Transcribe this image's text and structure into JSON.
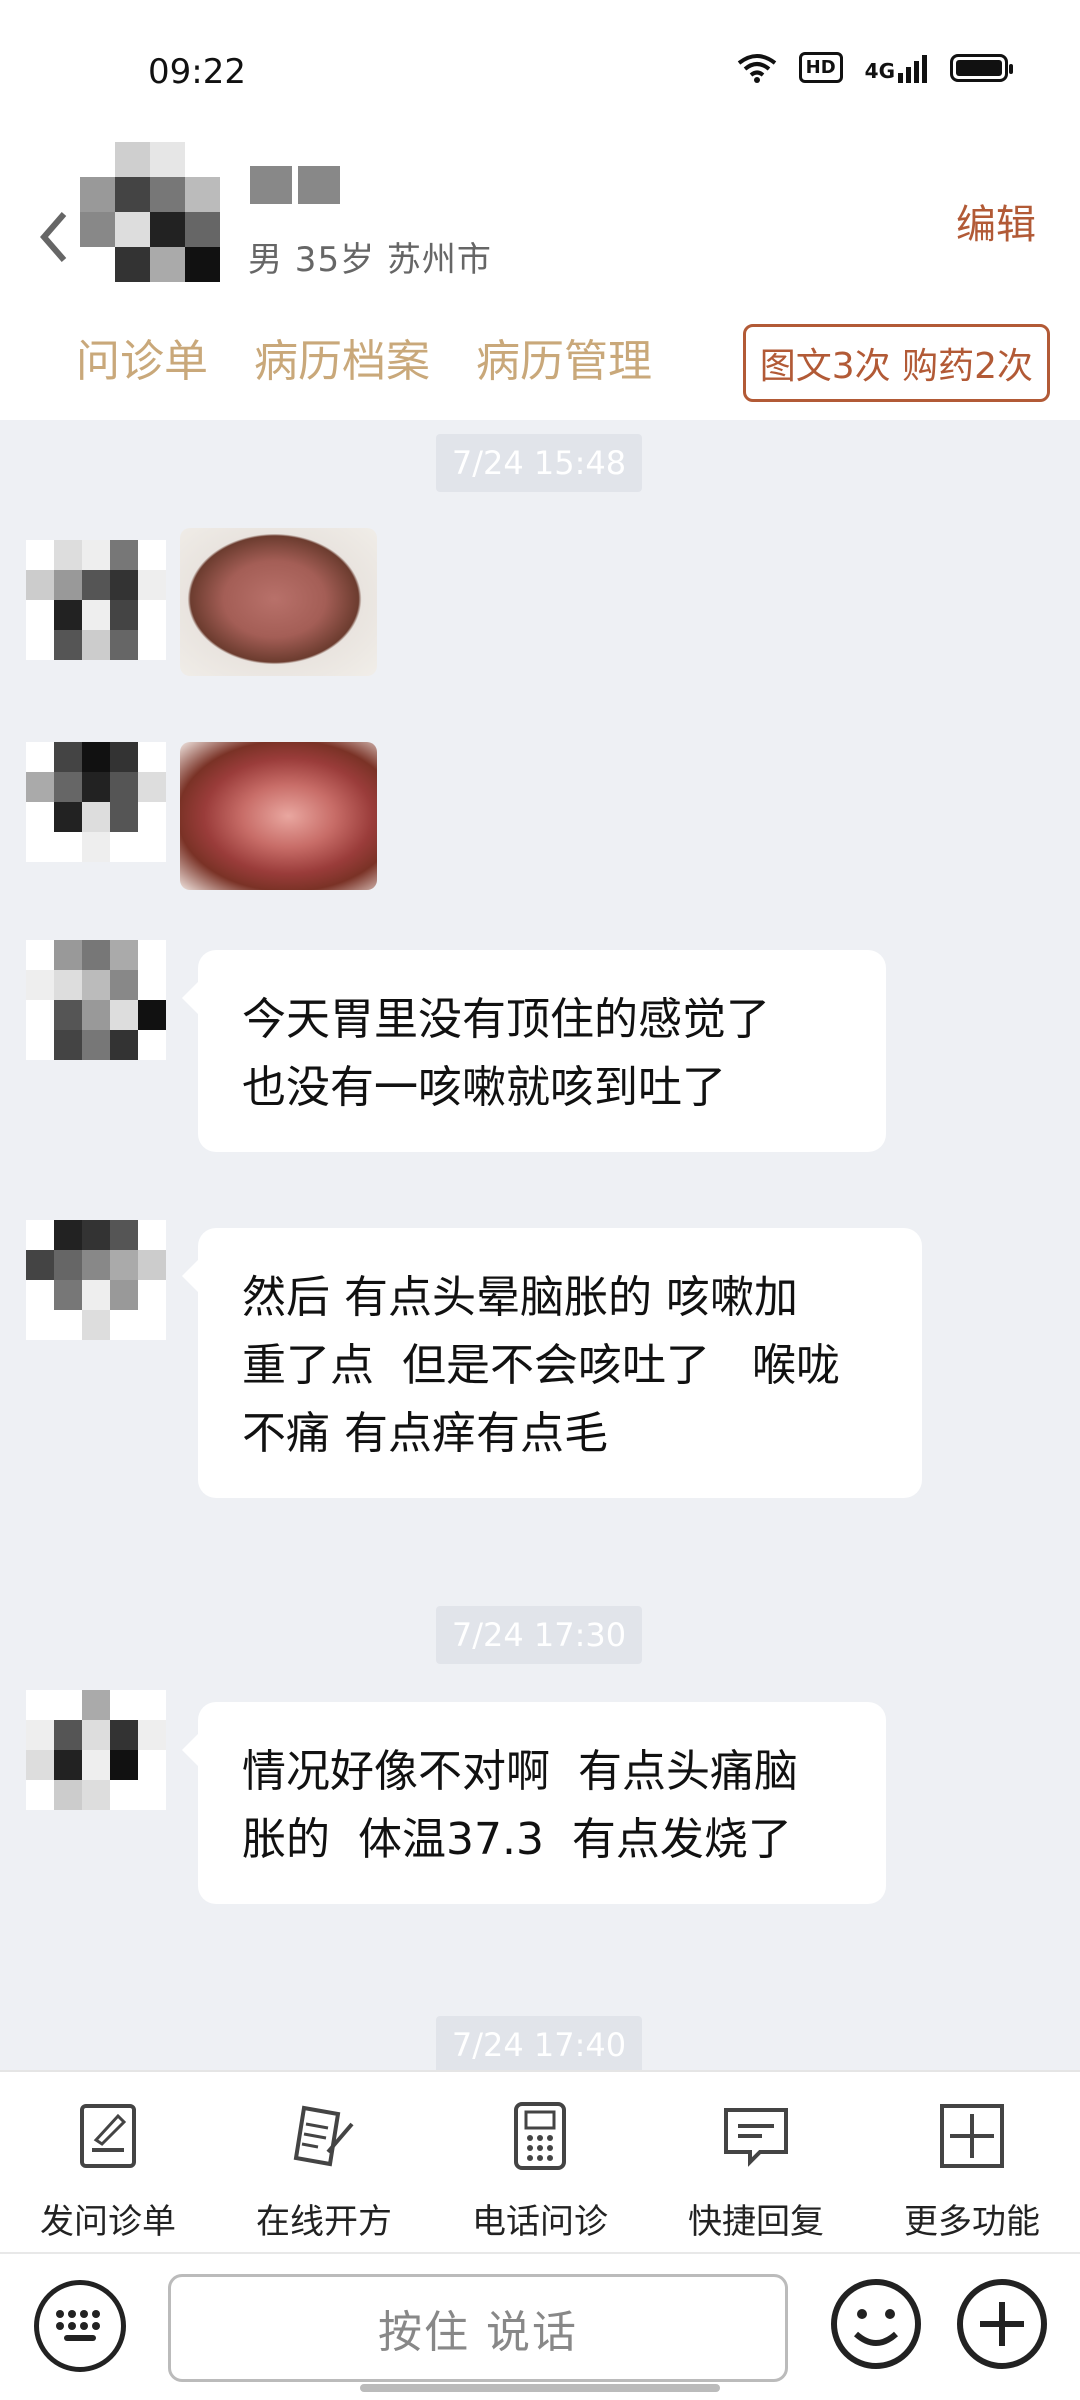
{
  "status_bar": {
    "time": "09:22",
    "hd": "HD",
    "network": "4G"
  },
  "patient": {
    "meta": "男 35岁  苏州市"
  },
  "header": {
    "edit_label": "编辑"
  },
  "tabs": [
    "问诊单",
    "病历档案",
    "病历管理"
  ],
  "badge": "图文3次 购药2次",
  "messages": {
    "time1": "7/24 15:48",
    "msg1": "今天胃里没有顶住的感觉了\n也没有一咳嗽就咳到吐了",
    "msg2": "然后 有点头晕脑胀的 咳嗽加\n重了点  但是不会咳吐了   喉咙\n不痛 有点痒有点毛",
    "time2": "7/24 17:30",
    "msg3": "情况好像不对啊  有点头痛脑\n胀的  体温37.3  有点发烧了",
    "time3": "7/24 17:40"
  },
  "toolbar": [
    {
      "label": "发问诊单",
      "icon": "form-edit-icon"
    },
    {
      "label": "在线开方",
      "icon": "prescription-icon"
    },
    {
      "label": "电话问诊",
      "icon": "phone-icon"
    },
    {
      "label": "快捷回复",
      "icon": "quick-reply-icon"
    },
    {
      "label": "更多功能",
      "icon": "plus-square-icon"
    }
  ],
  "input": {
    "hold_to_talk": "按住 说话"
  }
}
